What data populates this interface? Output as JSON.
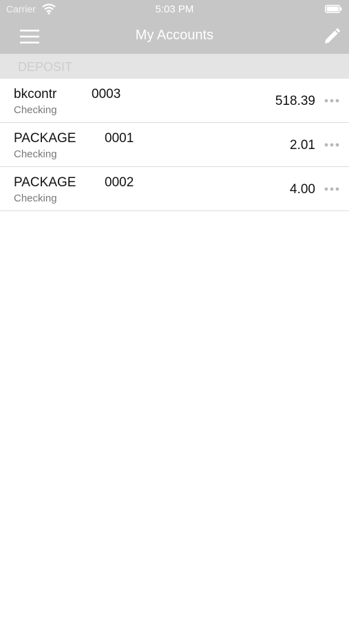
{
  "status_bar": {
    "carrier": "Carrier",
    "time": "5:03 PM"
  },
  "nav": {
    "title": "My Accounts",
    "menu_icon": "hamburger-menu-icon",
    "edit_icon": "pencil-icon"
  },
  "section": {
    "header": "DEPOSIT"
  },
  "accounts": [
    {
      "name": "bkcontr",
      "number": "0003",
      "type": "Checking",
      "balance": "518.39"
    },
    {
      "name": "PACKAGE",
      "number": "0001",
      "type": "Checking",
      "balance": "2.01"
    },
    {
      "name": "PACKAGE",
      "number": "0002",
      "type": "Checking",
      "balance": "4.00"
    }
  ],
  "colors": {
    "nav_bg": "#c6c6c6",
    "section_bg": "#e4e4e4",
    "text_primary": "#111111",
    "text_secondary": "#777777"
  }
}
